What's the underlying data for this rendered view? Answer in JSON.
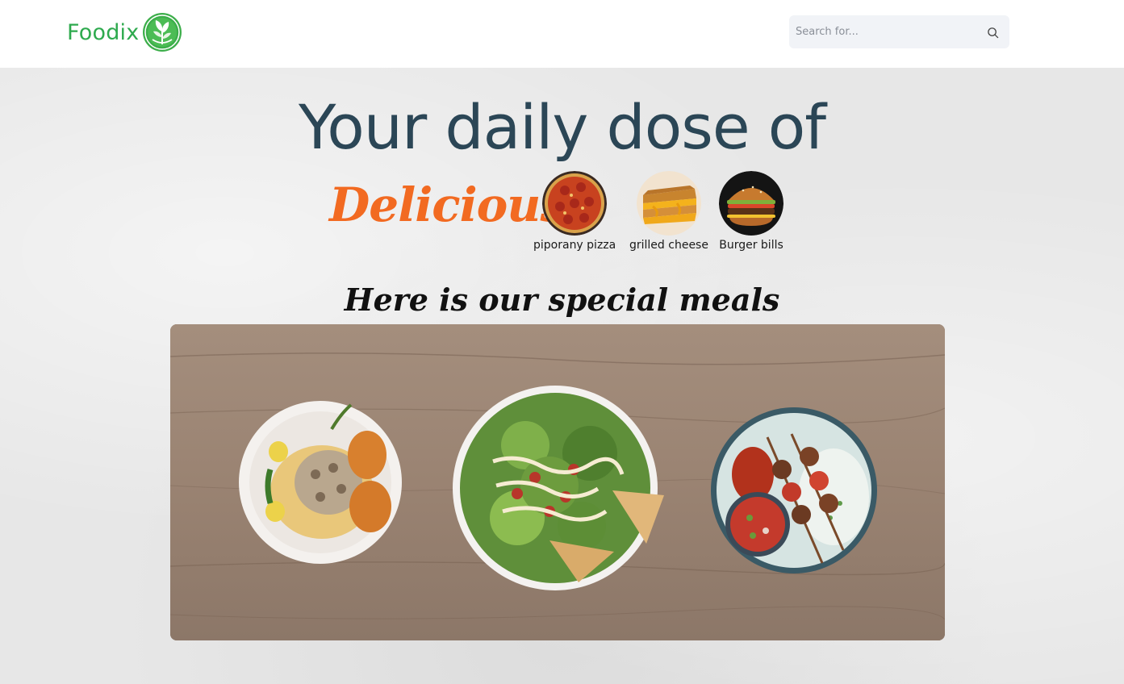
{
  "navbar": {
    "brand": "Foodix",
    "brand_logo_icon": "leaf-logo-icon",
    "search": {
      "placeholder": "Search for...",
      "icon": "search-icon"
    }
  },
  "hero": {
    "headline": "Your daily dose of",
    "highlight": "Delicious",
    "foods": [
      {
        "label": "piporany pizza",
        "icon": "pizza-icon"
      },
      {
        "label": "grilled cheese",
        "icon": "grilled-cheese-icon"
      },
      {
        "label": "Burger bills",
        "icon": "burger-icon"
      }
    ],
    "special_heading": "Here is our special meals",
    "meals": [
      "pasta-plate-image",
      "salad-plate-image",
      "kebab-plate-image"
    ]
  },
  "colors": {
    "brand": "#2eaa4e",
    "headline": "#2b4656",
    "highlight": "#f26a21",
    "navbar_bg": "#ffffff",
    "search_bg": "#f1f3f7"
  }
}
